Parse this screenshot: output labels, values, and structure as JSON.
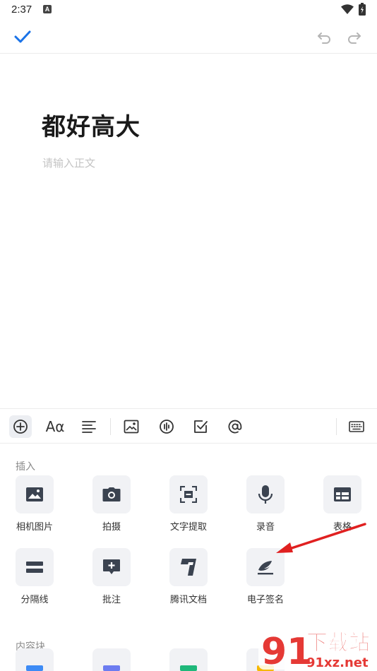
{
  "status_bar": {
    "time": "2:37",
    "notif_letter": "A"
  },
  "editor": {
    "title": "都好高大",
    "body_placeholder": "请输入正文"
  },
  "toolbar": {
    "font_label": "Aα"
  },
  "insert_section": {
    "label": "插入",
    "items": [
      {
        "label": "相机图片",
        "icon": "image-icon"
      },
      {
        "label": "拍摄",
        "icon": "camera-icon"
      },
      {
        "label": "文字提取",
        "icon": "text-scan-icon"
      },
      {
        "label": "录音",
        "icon": "microphone-icon"
      },
      {
        "label": "表格",
        "icon": "table-icon"
      },
      {
        "label": "分隔线",
        "icon": "divider-icon"
      },
      {
        "label": "批注",
        "icon": "comment-icon"
      },
      {
        "label": "腾讯文档",
        "icon": "tencent-docs-icon"
      },
      {
        "label": "电子签名",
        "icon": "signature-icon"
      }
    ]
  },
  "content_block_section": {
    "label": "内容块",
    "block_colors": [
      "#3d8bf5",
      "#6c7cf0",
      "#1fb87a",
      "#f5b800"
    ]
  },
  "watermark": {
    "number": "91",
    "title": "下载站",
    "domain": "91xz.net"
  },
  "colors": {
    "accent": "#1a73e8",
    "annotation_arrow": "#e02020"
  }
}
